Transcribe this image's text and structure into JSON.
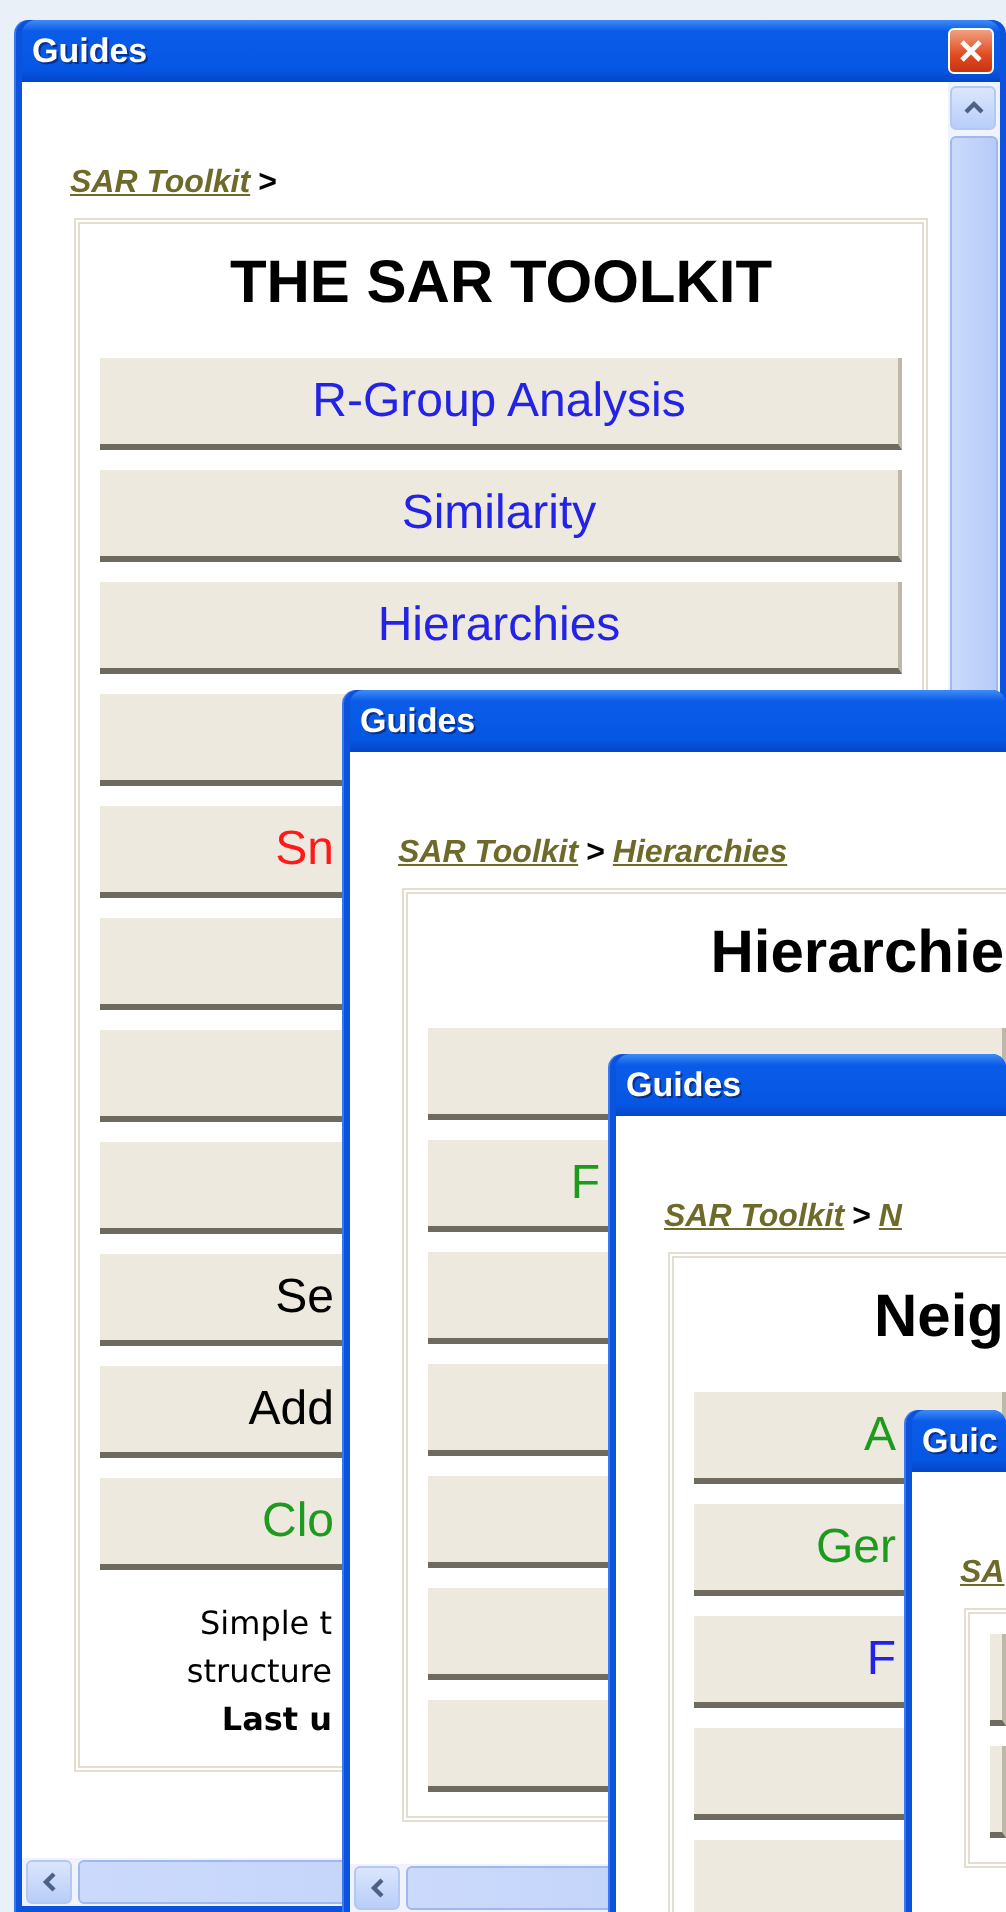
{
  "windows": [
    {
      "title": "Guides",
      "breadcrumb": [
        {
          "kind": "link",
          "text": "SAR Toolkit"
        },
        {
          "kind": "separator",
          "text": ">"
        }
      ],
      "heading": "THE SAR TOOLKIT",
      "buttons": [
        {
          "kind": "labelled",
          "label": "R-Group Analysis",
          "color": "#2323e6"
        },
        {
          "kind": "labelled",
          "label": "Similarity",
          "color": "#2323e6"
        },
        {
          "kind": "labelled",
          "label": "Hierarchies",
          "color": "#2323e6"
        },
        {
          "kind": "blank"
        },
        {
          "kind": "labelled",
          "label": "Sn",
          "color": "#ff1a1a"
        },
        {
          "kind": "blank"
        },
        {
          "kind": "blank"
        },
        {
          "kind": "blank"
        },
        {
          "kind": "labelled",
          "label": "Se",
          "color": "#000000"
        },
        {
          "kind": "labelled",
          "label": "Add",
          "color": "#000000"
        },
        {
          "kind": "labelled",
          "label": "Clo",
          "color": "#1e9a1e"
        }
      ],
      "notes": [
        {
          "text": "Simple t",
          "bold": false
        },
        {
          "text": "structure",
          "bold": false
        },
        {
          "text": "Last u",
          "bold": true
        }
      ]
    },
    {
      "title": "Guides",
      "breadcrumb": [
        {
          "kind": "link",
          "text": "SAR Toolkit"
        },
        {
          "kind": "separator",
          "text": ">"
        },
        {
          "kind": "link",
          "text": "Hierarchies"
        }
      ],
      "heading": "Hierarchie",
      "buttons": [
        {
          "kind": "blank"
        },
        {
          "kind": "labelled",
          "label": "F",
          "color": "#1e9a1e"
        },
        {
          "kind": "blank"
        },
        {
          "kind": "blank"
        },
        {
          "kind": "blank"
        },
        {
          "kind": "blank"
        },
        {
          "kind": "blank"
        }
      ]
    },
    {
      "title": "Guides",
      "breadcrumb": [
        {
          "kind": "link",
          "text": "SAR Toolkit"
        },
        {
          "kind": "separator",
          "text": ">"
        },
        {
          "kind": "link",
          "text": "N"
        }
      ],
      "heading": "Neig",
      "buttons": [
        {
          "kind": "labelled",
          "label": "A",
          "color": "#1e9a1e"
        },
        {
          "kind": "labelled",
          "label": "Ger",
          "color": "#1e9a1e"
        },
        {
          "kind": "labelled",
          "label": "F",
          "color": "#2323e6"
        },
        {
          "kind": "blank"
        },
        {
          "kind": "blank"
        }
      ]
    },
    {
      "title": "Guic",
      "breadcrumb": [
        {
          "kind": "link",
          "text": "SA"
        }
      ],
      "buttons": [
        {
          "kind": "blank"
        },
        {
          "kind": "blank"
        }
      ]
    }
  ]
}
